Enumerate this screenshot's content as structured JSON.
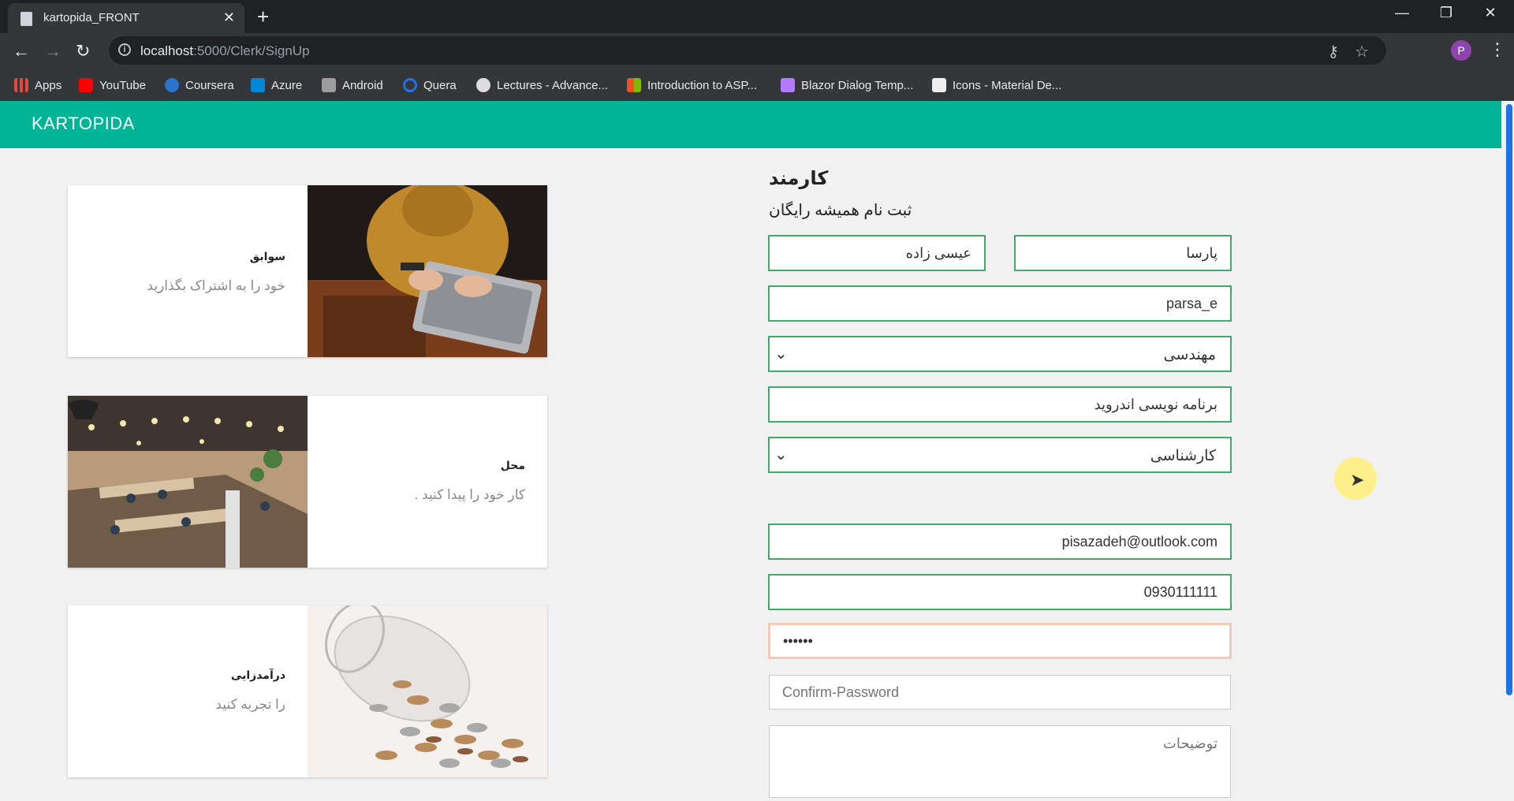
{
  "browser": {
    "tab_title": "kartopida_FRONT",
    "new_tab_label": "+",
    "close_tab_label": "✕",
    "window_buttons": {
      "minimize": "—",
      "restore": "❐",
      "close": "✕"
    },
    "url_host": "localhost",
    "url_path": ":5000/Clerk/SignUp",
    "profile_initial": "P",
    "bookmarks": [
      {
        "label": "Apps",
        "icon": "apps-grid-icon",
        "color": "#e8453c"
      },
      {
        "label": "YouTube",
        "icon": "youtube-icon",
        "color": "#ff0000"
      },
      {
        "label": "Coursera",
        "icon": "coursera-icon",
        "color": "#2a73cc"
      },
      {
        "label": "Azure",
        "icon": "azure-icon",
        "color": "#0089d6"
      },
      {
        "label": "Android",
        "icon": "android-icon",
        "color": "#cccccc"
      },
      {
        "label": "Quera",
        "icon": "quera-icon",
        "color": "#1a73e8"
      },
      {
        "label": "Lectures - Advance...",
        "icon": "globe-icon",
        "color": "#dddddd"
      },
      {
        "label": "Introduction to ASP...",
        "icon": "microsoft-icon",
        "color": "#f25022"
      },
      {
        "label": "Blazor Dialog Temp...",
        "icon": "blazor-icon",
        "color": "#b37bff"
      },
      {
        "label": "Icons - Material De...",
        "icon": "material-icon",
        "color": "#eeeeee"
      }
    ]
  },
  "app": {
    "brand": "KARTOPIDA",
    "accent_color": "#00b597"
  },
  "cards": [
    {
      "title": "سوابق",
      "subtitle": "خود را به اشتراک بگذارید",
      "photo": "laptop-photo"
    },
    {
      "title": "محل",
      "subtitle": "کار خود را پیدا کنید .",
      "photo": "office-photo"
    },
    {
      "title": "درآمدزایی",
      "subtitle": "را تجربه کنید",
      "photo": "coins-jar-photo"
    }
  ],
  "form": {
    "heading": "کارمند",
    "subheading": "ثبت نام همیشه رایگان",
    "first_name": "پارسا",
    "last_name": "عیسی زاده",
    "username": "parsa_e",
    "field_select": "مهندسی",
    "specialty": "برنامه نویسی اندروید",
    "degree_select": "کارشناسی",
    "email": "pisazadeh@outlook.com",
    "phone": "0930111111",
    "password": "••••••",
    "confirm_placeholder": "Confirm-Password",
    "description_placeholder": "توضیحات"
  }
}
